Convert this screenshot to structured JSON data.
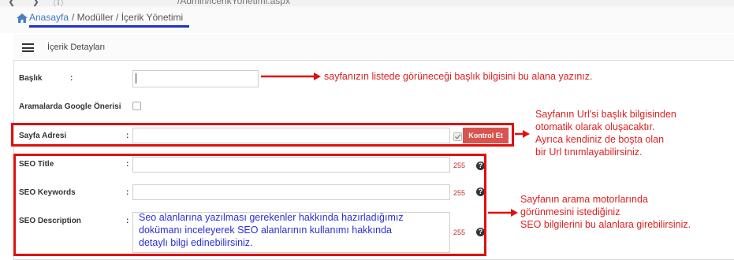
{
  "browser": {
    "url_fragment": "/Admin/icerikYonetimi.aspx"
  },
  "breadcrumb": {
    "home": "Anasayfa",
    "rest": "/ Modüller / İçerik Yönetimi"
  },
  "panel": {
    "title": "İçerik Detayları"
  },
  "form": {
    "baslik_label": "Başlık",
    "google_label": "Aramalarda Google Önerisi",
    "sayfa_label": "Sayfa Adresi",
    "seo_title_label": "SEO Title",
    "seo_keywords_label": "SEO Keywords",
    "seo_description_label": "SEO Description",
    "colon": ":",
    "kontrol_button": "Kontrol Et",
    "counter_title": "255",
    "counter_keywords": "255",
    "counter_description": "255",
    "help_glyph": "?"
  },
  "annotations": {
    "baslik_note": "sayfanızın listede görüneceği başlık bilgisini bu alana yazınız.",
    "url_note": [
      "Sayfanın Url'si başlık bilgisinden",
      "otomatik olarak oluşacaktır.",
      "Ayrıca kendiniz de boşta olan",
      "bir Url tınımlayabilirsiniz."
    ],
    "seo_note": [
      "Sayfanın arama motorlarında",
      "görünmesini istediğiniz",
      "SEO bilgilerini bu alanlara girebilirsiniz."
    ],
    "description_text": [
      "Seo alanlarına yazılması gerekenler hakkında hazırladığımız",
      "dokümanı inceleyerek SEO alanlarının kullanımı hakkında",
      "detaylı bilgi edinebilirsiniz."
    ]
  },
  "colors": {
    "accent_red": "#e01010",
    "button_red": "#d9534f",
    "link_blue": "#3d78c2",
    "note_blue": "#2a2fd6"
  }
}
